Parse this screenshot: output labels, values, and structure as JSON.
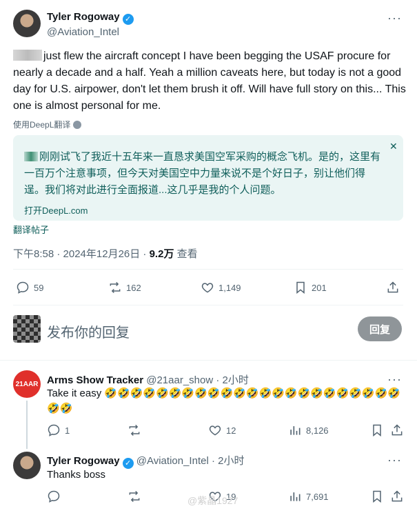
{
  "tweet": {
    "author_name": "Tyler Rogoway",
    "author_handle": "@Aviation_Intel",
    "text": "just flew the aircraft concept I have been begging the USAF procure for nearly a decade and a half. Yeah a million caveats here, but today is not a good day for U.S. airpower, don't let them brush it off. Will have full story on this... This one is almost personal for me.",
    "translated_by": "使用DeepL翻译",
    "translation": "刚刚试飞了我近十五年来一直恳求美国空军采购的概念飞机。是的，这里有一百万个注意事项，但今天对美国空中力量来说不是个好日子，别让他们得逞。我们将对此进行全面报道...这几乎是我的个人问题。",
    "open_deepl": "打开DeepL.com",
    "translate_post": "翻译帖子",
    "time": "下午8:58 · 2024年12月26日 · ",
    "views": "9.2万",
    "views_label": " 查看",
    "stats": {
      "replies": "59",
      "reposts": "162",
      "likes": "1,149",
      "bookmarks": "201"
    }
  },
  "compose": {
    "placeholder": "发布你的回复",
    "button": "回复"
  },
  "replies": [
    {
      "avatar_text": "21AAR",
      "name": "Arms Show Tracker",
      "handle": "@21aar_show",
      "time": " · 2小时",
      "text": "Take it easy 🤣🤣🤣🤣🤣🤣🤣🤣🤣🤣🤣🤣🤣🤣🤣🤣🤣🤣🤣🤣🤣🤣🤣🤣🤣",
      "replies": "1",
      "reposts": "",
      "likes": "12",
      "views": "8,126"
    },
    {
      "name": "Tyler Rogoway",
      "handle": "@Aviation_Intel",
      "time": " · 2小时",
      "text": "Thanks boss",
      "replies": "",
      "reposts": "",
      "likes": "19",
      "views": "7,691"
    }
  ],
  "watermark": "@紫晶1927",
  "colors": {
    "accent": "#1d9bf0",
    "translation_bg": "#eaf5f4",
    "translation_text": "#0f5e5a",
    "reply_button": "#8f9599"
  }
}
